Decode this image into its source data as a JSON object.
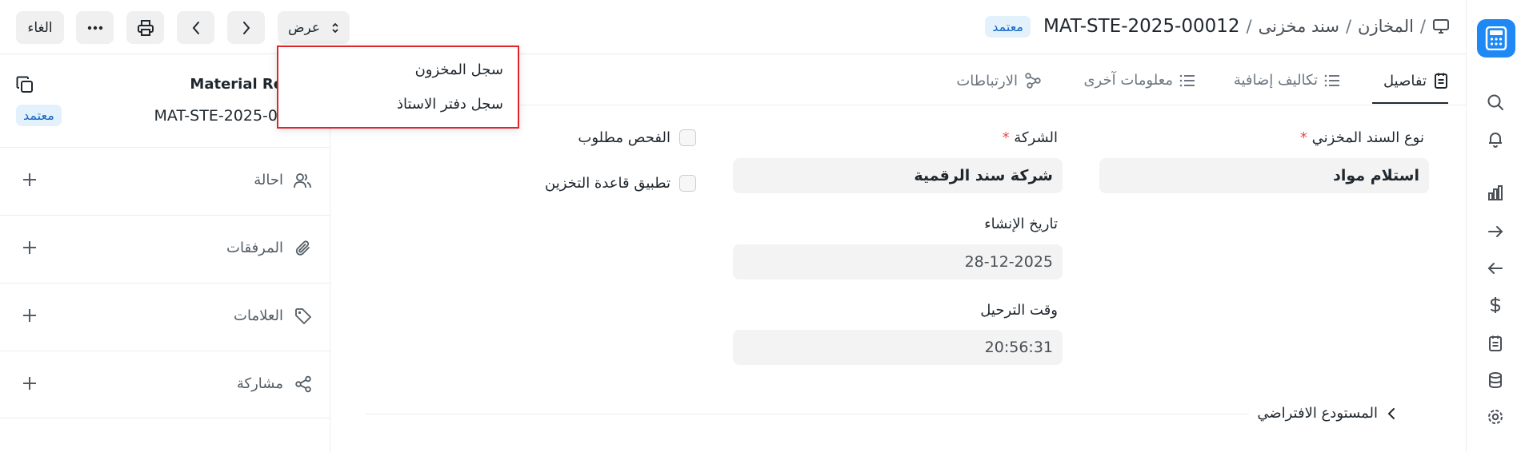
{
  "breadcrumb": {
    "items": [
      "المخازن",
      "سند مخزنى"
    ],
    "separator": "/",
    "doc_id": "MAT-STE-2025-00012",
    "status": "معتمد"
  },
  "toolbar": {
    "view_label": "عرض",
    "cancel_label": "الغاء"
  },
  "view_menu": {
    "items": [
      "سجل المخزون",
      "سجل دفتر الاستاذ"
    ]
  },
  "sidebar": {
    "title": "Material Re",
    "doc_id": "MAT-STE-2025-0",
    "status": "معتمد",
    "sections": [
      {
        "label": "احالة",
        "icon": "users-icon"
      },
      {
        "label": "المرفقات",
        "icon": "paperclip-icon"
      },
      {
        "label": "العلامات",
        "icon": "tag-icon"
      },
      {
        "label": "مشاركة",
        "icon": "share-icon"
      }
    ]
  },
  "tabs": [
    {
      "label": "تفاصيل",
      "icon": "clipboard-icon",
      "active": true
    },
    {
      "label": "تكاليف إضافية",
      "icon": "list-icon",
      "active": false
    },
    {
      "label": "معلومات آخرى",
      "icon": "list-icon",
      "active": false
    },
    {
      "label": "الارتباطات",
      "icon": "connections-icon",
      "active": false
    }
  ],
  "form": {
    "entry_type": {
      "label": "نوع السند المخزني",
      "required_mark": "*",
      "value": "استلام مواد"
    },
    "company": {
      "label": "الشركة",
      "required_mark": "*",
      "value": "شركة سند الرقمية"
    },
    "posting_date": {
      "label": "تاريخ الإنشاء",
      "value": "28-12-2025"
    },
    "posting_time": {
      "label": "وقت الترحيل",
      "value": "20:56:31"
    },
    "inspection_required": {
      "label": "الفحص مطلوب",
      "checked": false
    },
    "apply_putaway_rule": {
      "label": "تطبيق قاعدة التخزين",
      "checked": false
    },
    "default_warehouse_section": {
      "label": "المستودع الافتراضي"
    }
  },
  "colors": {
    "accent": "#1e88f5",
    "badge_bg": "#e3f1fd",
    "badge_text": "#1366c2",
    "highlight_border": "#e0262b"
  }
}
